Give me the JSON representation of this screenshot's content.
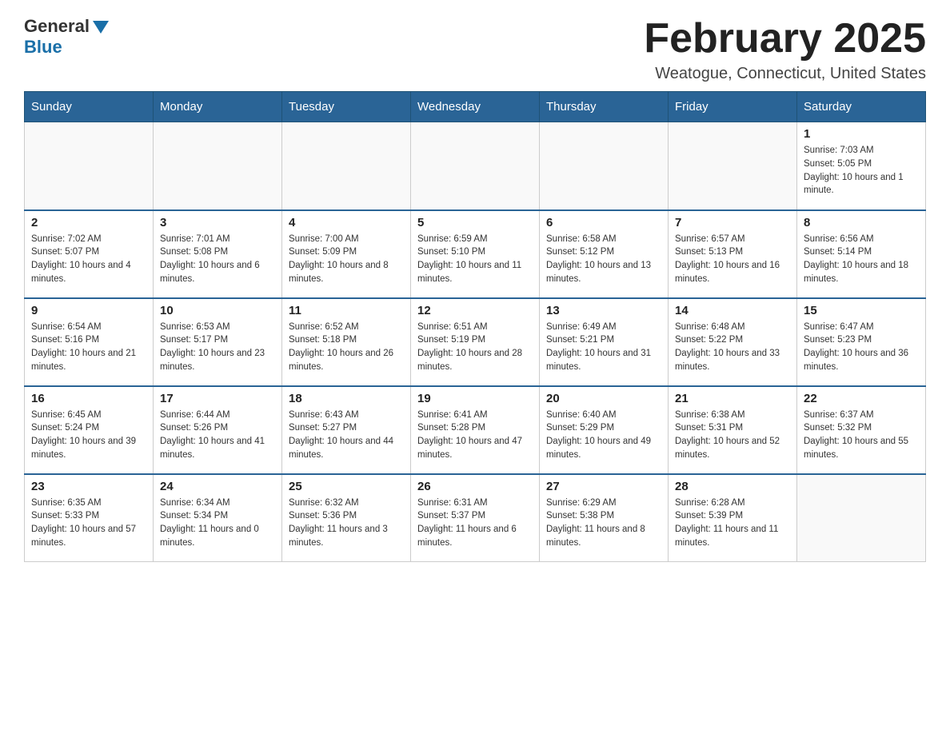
{
  "header": {
    "logo_general": "General",
    "logo_blue": "Blue",
    "month_title": "February 2025",
    "location": "Weatogue, Connecticut, United States"
  },
  "days_of_week": [
    "Sunday",
    "Monday",
    "Tuesday",
    "Wednesday",
    "Thursday",
    "Friday",
    "Saturday"
  ],
  "weeks": [
    [
      {
        "day": "",
        "sunrise": "",
        "sunset": "",
        "daylight": ""
      },
      {
        "day": "",
        "sunrise": "",
        "sunset": "",
        "daylight": ""
      },
      {
        "day": "",
        "sunrise": "",
        "sunset": "",
        "daylight": ""
      },
      {
        "day": "",
        "sunrise": "",
        "sunset": "",
        "daylight": ""
      },
      {
        "day": "",
        "sunrise": "",
        "sunset": "",
        "daylight": ""
      },
      {
        "day": "",
        "sunrise": "",
        "sunset": "",
        "daylight": ""
      },
      {
        "day": "1",
        "sunrise": "Sunrise: 7:03 AM",
        "sunset": "Sunset: 5:05 PM",
        "daylight": "Daylight: 10 hours and 1 minute."
      }
    ],
    [
      {
        "day": "2",
        "sunrise": "Sunrise: 7:02 AM",
        "sunset": "Sunset: 5:07 PM",
        "daylight": "Daylight: 10 hours and 4 minutes."
      },
      {
        "day": "3",
        "sunrise": "Sunrise: 7:01 AM",
        "sunset": "Sunset: 5:08 PM",
        "daylight": "Daylight: 10 hours and 6 minutes."
      },
      {
        "day": "4",
        "sunrise": "Sunrise: 7:00 AM",
        "sunset": "Sunset: 5:09 PM",
        "daylight": "Daylight: 10 hours and 8 minutes."
      },
      {
        "day": "5",
        "sunrise": "Sunrise: 6:59 AM",
        "sunset": "Sunset: 5:10 PM",
        "daylight": "Daylight: 10 hours and 11 minutes."
      },
      {
        "day": "6",
        "sunrise": "Sunrise: 6:58 AM",
        "sunset": "Sunset: 5:12 PM",
        "daylight": "Daylight: 10 hours and 13 minutes."
      },
      {
        "day": "7",
        "sunrise": "Sunrise: 6:57 AM",
        "sunset": "Sunset: 5:13 PM",
        "daylight": "Daylight: 10 hours and 16 minutes."
      },
      {
        "day": "8",
        "sunrise": "Sunrise: 6:56 AM",
        "sunset": "Sunset: 5:14 PM",
        "daylight": "Daylight: 10 hours and 18 minutes."
      }
    ],
    [
      {
        "day": "9",
        "sunrise": "Sunrise: 6:54 AM",
        "sunset": "Sunset: 5:16 PM",
        "daylight": "Daylight: 10 hours and 21 minutes."
      },
      {
        "day": "10",
        "sunrise": "Sunrise: 6:53 AM",
        "sunset": "Sunset: 5:17 PM",
        "daylight": "Daylight: 10 hours and 23 minutes."
      },
      {
        "day": "11",
        "sunrise": "Sunrise: 6:52 AM",
        "sunset": "Sunset: 5:18 PM",
        "daylight": "Daylight: 10 hours and 26 minutes."
      },
      {
        "day": "12",
        "sunrise": "Sunrise: 6:51 AM",
        "sunset": "Sunset: 5:19 PM",
        "daylight": "Daylight: 10 hours and 28 minutes."
      },
      {
        "day": "13",
        "sunrise": "Sunrise: 6:49 AM",
        "sunset": "Sunset: 5:21 PM",
        "daylight": "Daylight: 10 hours and 31 minutes."
      },
      {
        "day": "14",
        "sunrise": "Sunrise: 6:48 AM",
        "sunset": "Sunset: 5:22 PM",
        "daylight": "Daylight: 10 hours and 33 minutes."
      },
      {
        "day": "15",
        "sunrise": "Sunrise: 6:47 AM",
        "sunset": "Sunset: 5:23 PM",
        "daylight": "Daylight: 10 hours and 36 minutes."
      }
    ],
    [
      {
        "day": "16",
        "sunrise": "Sunrise: 6:45 AM",
        "sunset": "Sunset: 5:24 PM",
        "daylight": "Daylight: 10 hours and 39 minutes."
      },
      {
        "day": "17",
        "sunrise": "Sunrise: 6:44 AM",
        "sunset": "Sunset: 5:26 PM",
        "daylight": "Daylight: 10 hours and 41 minutes."
      },
      {
        "day": "18",
        "sunrise": "Sunrise: 6:43 AM",
        "sunset": "Sunset: 5:27 PM",
        "daylight": "Daylight: 10 hours and 44 minutes."
      },
      {
        "day": "19",
        "sunrise": "Sunrise: 6:41 AM",
        "sunset": "Sunset: 5:28 PM",
        "daylight": "Daylight: 10 hours and 47 minutes."
      },
      {
        "day": "20",
        "sunrise": "Sunrise: 6:40 AM",
        "sunset": "Sunset: 5:29 PM",
        "daylight": "Daylight: 10 hours and 49 minutes."
      },
      {
        "day": "21",
        "sunrise": "Sunrise: 6:38 AM",
        "sunset": "Sunset: 5:31 PM",
        "daylight": "Daylight: 10 hours and 52 minutes."
      },
      {
        "day": "22",
        "sunrise": "Sunrise: 6:37 AM",
        "sunset": "Sunset: 5:32 PM",
        "daylight": "Daylight: 10 hours and 55 minutes."
      }
    ],
    [
      {
        "day": "23",
        "sunrise": "Sunrise: 6:35 AM",
        "sunset": "Sunset: 5:33 PM",
        "daylight": "Daylight: 10 hours and 57 minutes."
      },
      {
        "day": "24",
        "sunrise": "Sunrise: 6:34 AM",
        "sunset": "Sunset: 5:34 PM",
        "daylight": "Daylight: 11 hours and 0 minutes."
      },
      {
        "day": "25",
        "sunrise": "Sunrise: 6:32 AM",
        "sunset": "Sunset: 5:36 PM",
        "daylight": "Daylight: 11 hours and 3 minutes."
      },
      {
        "day": "26",
        "sunrise": "Sunrise: 6:31 AM",
        "sunset": "Sunset: 5:37 PM",
        "daylight": "Daylight: 11 hours and 6 minutes."
      },
      {
        "day": "27",
        "sunrise": "Sunrise: 6:29 AM",
        "sunset": "Sunset: 5:38 PM",
        "daylight": "Daylight: 11 hours and 8 minutes."
      },
      {
        "day": "28",
        "sunrise": "Sunrise: 6:28 AM",
        "sunset": "Sunset: 5:39 PM",
        "daylight": "Daylight: 11 hours and 11 minutes."
      },
      {
        "day": "",
        "sunrise": "",
        "sunset": "",
        "daylight": ""
      }
    ]
  ]
}
